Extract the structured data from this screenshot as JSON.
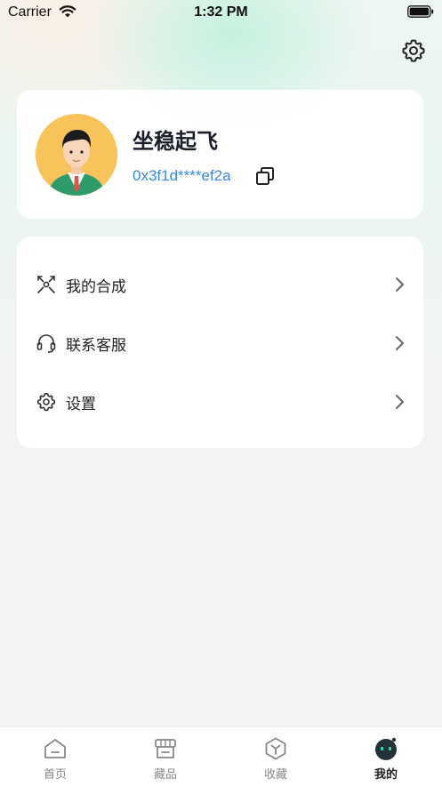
{
  "status_bar": {
    "carrier": "Carrier",
    "time": "1:32 PM"
  },
  "header": {
    "settings_icon": "gear-icon"
  },
  "profile": {
    "username": "坐稳起飞",
    "address": "0x3f1d****ef2a",
    "avatar": "avatar-man-in-suit",
    "copy_icon": "copy-icon"
  },
  "menu": {
    "items": [
      {
        "label": "我的合成",
        "icon": "synthesis-icon"
      },
      {
        "label": "联系客服",
        "icon": "headset-icon"
      },
      {
        "label": "设置",
        "icon": "gear-icon"
      }
    ]
  },
  "tabbar": {
    "tabs": [
      {
        "label": "首页",
        "icon": "home-icon",
        "active": false
      },
      {
        "label": "藏品",
        "icon": "store-icon",
        "active": false
      },
      {
        "label": "收藏",
        "icon": "cube-icon",
        "active": false
      },
      {
        "label": "我的",
        "icon": "robot-icon",
        "active": true
      }
    ]
  },
  "colors": {
    "accent_blue": "#3a86e6",
    "avatar_bg": "#f7c35a",
    "page_bg": "#f2f3f5"
  }
}
